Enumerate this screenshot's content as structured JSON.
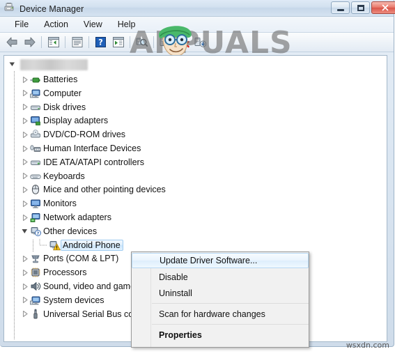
{
  "window": {
    "title": "Device Manager",
    "icon": "device-manager-icon",
    "controls": {
      "minimize": "Minimize",
      "maximize": "Maximize",
      "close": "Close"
    }
  },
  "menubar": {
    "items": [
      {
        "label": "File"
      },
      {
        "label": "Action"
      },
      {
        "label": "View"
      },
      {
        "label": "Help"
      }
    ]
  },
  "toolbar": {
    "buttons": [
      {
        "name": "back-arrow-icon",
        "tooltip": "Back"
      },
      {
        "name": "forward-arrow-icon",
        "tooltip": "Forward"
      },
      {
        "name": "separator-1"
      },
      {
        "name": "show-hide-console-tree-icon",
        "tooltip": "Show/Hide Console Tree"
      },
      {
        "name": "separator-2"
      },
      {
        "name": "properties-icon",
        "tooltip": "Properties"
      },
      {
        "name": "separator-3"
      },
      {
        "name": "help-icon",
        "tooltip": "Help"
      },
      {
        "name": "show-hide-action-pane-icon",
        "tooltip": "Show/Hide Action Pane"
      },
      {
        "name": "separator-4"
      },
      {
        "name": "scan-for-hardware-changes-icon",
        "tooltip": "Scan for hardware changes"
      },
      {
        "name": "separator-5"
      },
      {
        "name": "update-driver-software-icon",
        "tooltip": "Update Driver Software"
      },
      {
        "name": "disable-device-icon",
        "tooltip": "Disable"
      },
      {
        "name": "uninstall-device-icon",
        "tooltip": "Uninstall"
      }
    ]
  },
  "tree": {
    "root": {
      "label": "",
      "redacted": true,
      "expanded": true
    },
    "nodes": [
      {
        "label": "Batteries",
        "icon": "battery-icon",
        "expandable": true,
        "expanded": false,
        "indent": 0,
        "selected": false,
        "warning": false
      },
      {
        "label": "Computer",
        "icon": "computer-icon",
        "expandable": true,
        "expanded": false,
        "indent": 0,
        "selected": false,
        "warning": false
      },
      {
        "label": "Disk drives",
        "icon": "disk-drive-icon",
        "expandable": true,
        "expanded": false,
        "indent": 0,
        "selected": false,
        "warning": false
      },
      {
        "label": "Display adapters",
        "icon": "display-icon",
        "expandable": true,
        "expanded": false,
        "indent": 0,
        "selected": false,
        "warning": false
      },
      {
        "label": "DVD/CD-ROM drives",
        "icon": "optical-drive-icon",
        "expandable": true,
        "expanded": false,
        "indent": 0,
        "selected": false,
        "warning": false
      },
      {
        "label": "Human Interface Devices",
        "icon": "hid-icon",
        "expandable": true,
        "expanded": false,
        "indent": 0,
        "selected": false,
        "warning": false
      },
      {
        "label": "IDE ATA/ATAPI controllers",
        "icon": "ide-controller-icon",
        "expandable": true,
        "expanded": false,
        "indent": 0,
        "selected": false,
        "warning": false
      },
      {
        "label": "Keyboards",
        "icon": "keyboard-icon",
        "expandable": true,
        "expanded": false,
        "indent": 0,
        "selected": false,
        "warning": false
      },
      {
        "label": "Mice and other pointing devices",
        "icon": "mouse-icon",
        "expandable": true,
        "expanded": false,
        "indent": 0,
        "selected": false,
        "warning": false
      },
      {
        "label": "Monitors",
        "icon": "monitor-icon",
        "expandable": true,
        "expanded": false,
        "indent": 0,
        "selected": false,
        "warning": false
      },
      {
        "label": "Network adapters",
        "icon": "network-adapter-icon",
        "expandable": true,
        "expanded": false,
        "indent": 0,
        "selected": false,
        "warning": false
      },
      {
        "label": "Other devices",
        "icon": "other-devices-icon",
        "expandable": true,
        "expanded": true,
        "indent": 0,
        "selected": false,
        "warning": false
      },
      {
        "label": "Android Phone",
        "icon": "unknown-device-icon",
        "expandable": false,
        "expanded": false,
        "indent": 1,
        "selected": true,
        "warning": true
      },
      {
        "label": "Ports (COM & LPT)",
        "icon": "port-icon",
        "expandable": true,
        "expanded": false,
        "indent": 0,
        "selected": false,
        "warning": false
      },
      {
        "label": "Processors",
        "icon": "processor-icon",
        "expandable": true,
        "expanded": false,
        "indent": 0,
        "selected": false,
        "warning": false
      },
      {
        "label": "Sound, video and game controllers",
        "icon": "sound-icon",
        "expandable": true,
        "expanded": false,
        "indent": 0,
        "selected": false,
        "warning": false
      },
      {
        "label": "System devices",
        "icon": "system-device-icon",
        "expandable": true,
        "expanded": false,
        "indent": 0,
        "selected": false,
        "warning": false
      },
      {
        "label": "Universal Serial Bus controllers",
        "icon": "usb-icon",
        "expandable": true,
        "expanded": false,
        "indent": 0,
        "selected": false,
        "warning": false
      }
    ]
  },
  "context_menu": {
    "items": [
      {
        "label": "Update Driver Software...",
        "highlighted": true,
        "bold": false,
        "separator_after": false
      },
      {
        "label": "Disable",
        "highlighted": false,
        "bold": false,
        "separator_after": false
      },
      {
        "label": "Uninstall",
        "highlighted": false,
        "bold": false,
        "separator_after": true
      },
      {
        "label": "Scan for hardware changes",
        "highlighted": false,
        "bold": false,
        "separator_after": true
      },
      {
        "label": "Properties",
        "highlighted": false,
        "bold": true,
        "separator_after": false
      }
    ]
  },
  "watermarks": {
    "brand": "APPUALS",
    "site": "wsxdn.com"
  },
  "colors": {
    "selection": "#cbe5fb",
    "selection_border": "#9fcbf0",
    "titlebar": "#d2e0ef",
    "warning": "#f5c518",
    "close_button": "#d9554a"
  }
}
